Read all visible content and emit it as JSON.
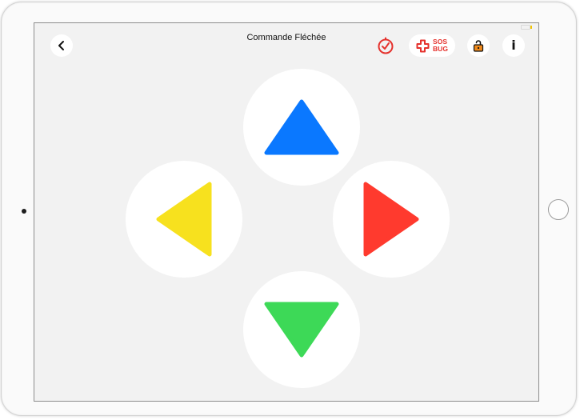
{
  "header": {
    "title": "Commande Fléchée",
    "sos_line1": "SOS",
    "sos_line2": "BUG"
  },
  "icons": {
    "back": "chevron-left-icon",
    "timer": "timer-check-icon",
    "sos": "medical-cross-icon",
    "lock": "unlocked-padlock-icon",
    "info": "info-icon",
    "info_glyph": "i"
  },
  "directions": [
    {
      "direction": "up",
      "color": "#0a78ff"
    },
    {
      "direction": "left",
      "color": "#f7e11e"
    },
    {
      "direction": "right",
      "color": "#ff3a2e"
    },
    {
      "direction": "down",
      "color": "#3dd957"
    }
  ],
  "colors": {
    "screen_background": "#f2f2f2",
    "button_background": "#ffffff",
    "accent_red": "#e5322d",
    "lock_orange": "#f08a1c"
  }
}
